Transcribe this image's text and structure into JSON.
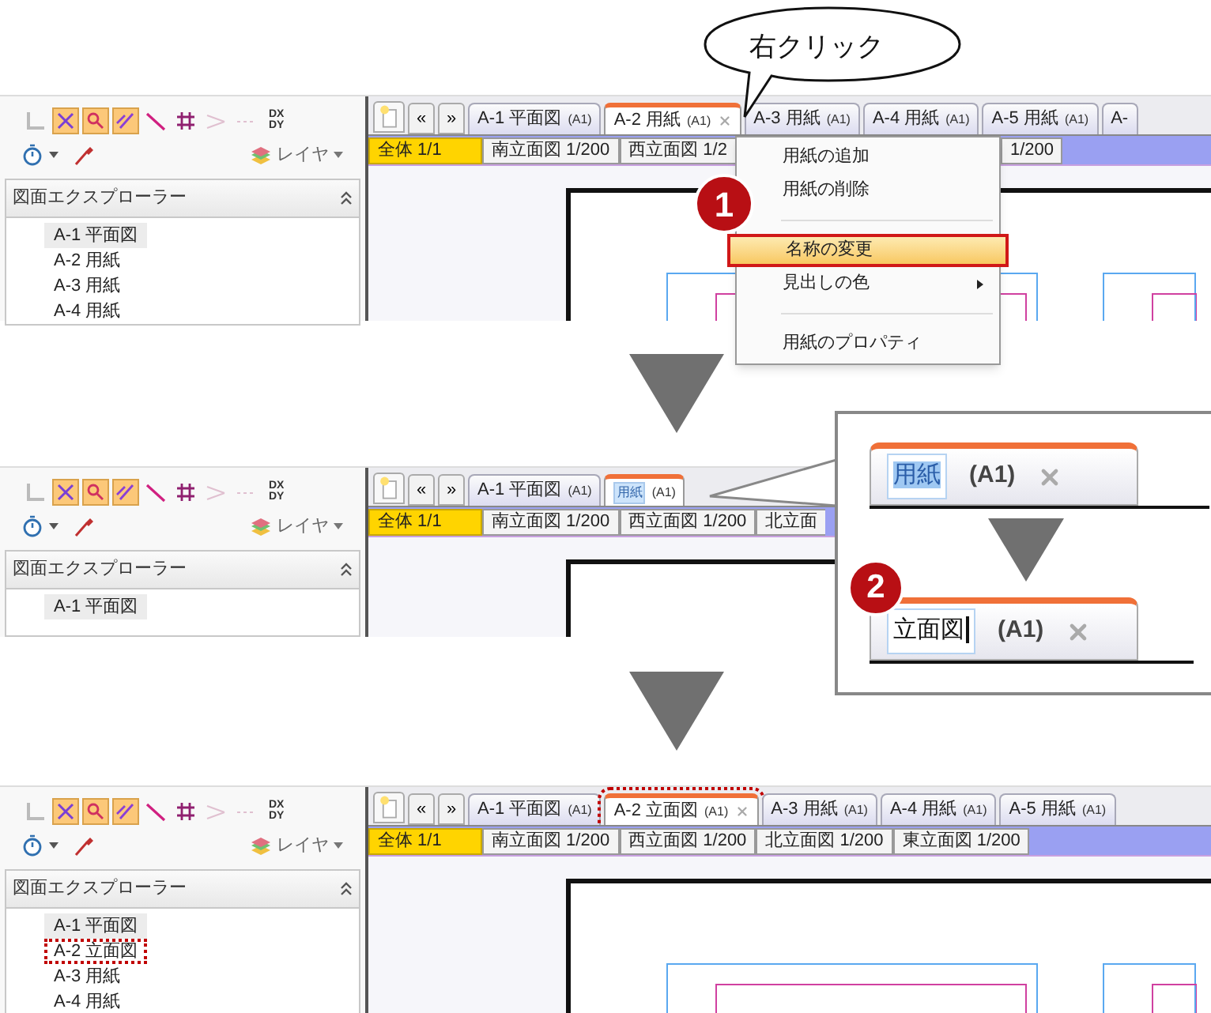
{
  "bubble": {
    "text": "右クリック"
  },
  "steps": [
    {
      "nav": {
        "prev": "«",
        "next": "»"
      },
      "toolbar": {
        "dxdy": "DX DY",
        "layer": "レイヤ"
      },
      "explorer": {
        "title": "図面エクスプローラー",
        "items": [
          {
            "label": "A-1 平面図",
            "selected": true,
            "marked": false
          },
          {
            "label": "A-2 用紙",
            "selected": false,
            "marked": false
          },
          {
            "label": "A-3 用紙",
            "selected": false,
            "marked": false
          },
          {
            "label": "A-4 用紙",
            "selected": false,
            "marked": false
          }
        ]
      },
      "page_tabs": [
        {
          "kind": "tab",
          "label": "A-1 平面図",
          "size": "(A1)",
          "selected": false,
          "marked": false
        },
        {
          "kind": "tab",
          "label": "A-2 用紙",
          "size": "(A1)",
          "selected": true,
          "marked": false
        },
        {
          "kind": "tab",
          "label": "A-3 用紙",
          "size": "(A1)",
          "selected": false,
          "marked": false
        },
        {
          "kind": "tab",
          "label": "A-4 用紙",
          "size": "(A1)",
          "selected": false,
          "marked": false
        },
        {
          "kind": "tab",
          "label": "A-5 用紙",
          "size": "(A1)",
          "selected": false,
          "marked": false
        },
        {
          "kind": "cut",
          "label": "A-",
          "selected": false,
          "marked": false
        }
      ],
      "sheet_tabs": [
        {
          "kind": "tab",
          "label": "全体 1/1",
          "selected": true
        },
        {
          "kind": "tab",
          "label": "南立面図 1/200",
          "selected": false
        },
        {
          "kind": "cut",
          "label": "西立面図 1/2",
          "selected": false
        },
        {
          "kind": "tail",
          "label": "1/200",
          "selected": false
        }
      ],
      "context_menu": {
        "badge": "1",
        "items": [
          {
            "kind": "item",
            "label": "用紙の追加",
            "marked": false,
            "submenu": false
          },
          {
            "kind": "item",
            "label": "用紙の削除",
            "marked": false,
            "submenu": false
          },
          {
            "kind": "separator"
          },
          {
            "kind": "item",
            "label": "名称の変更",
            "marked": true,
            "submenu": false
          },
          {
            "kind": "item",
            "label": "見出しの色",
            "marked": false,
            "submenu": true
          },
          {
            "kind": "separator"
          },
          {
            "kind": "item",
            "label": "用紙のプロパティ",
            "marked": false,
            "submenu": false
          }
        ]
      }
    },
    {
      "nav": {
        "prev": "«",
        "next": "»"
      },
      "toolbar": {
        "dxdy": "DX DY",
        "layer": "レイヤ"
      },
      "explorer": {
        "title": "図面エクスプローラー",
        "items": [
          {
            "label": "A-1 平面図",
            "selected": true,
            "marked": false
          }
        ]
      },
      "page_tabs": [
        {
          "kind": "tab",
          "label": "A-1 平面図",
          "size": "(A1)",
          "selected": false,
          "marked": false
        },
        {
          "kind": "editing",
          "label": "用紙",
          "size": "(A1)",
          "selected": true,
          "marked": false
        }
      ],
      "sheet_tabs": [
        {
          "kind": "tab",
          "label": "全体 1/1",
          "selected": true
        },
        {
          "kind": "tab",
          "label": "南立面図 1/200",
          "selected": false
        },
        {
          "kind": "tab",
          "label": "西立面図 1/200",
          "selected": false
        },
        {
          "kind": "cut",
          "label": "北立面",
          "selected": false
        }
      ]
    },
    {
      "nav": {
        "prev": "«",
        "next": "»"
      },
      "toolbar": {
        "dxdy": "DX DY",
        "layer": "レイヤ"
      },
      "explorer": {
        "title": "図面エクスプローラー",
        "items": [
          {
            "label": "A-1 平面図",
            "selected": true,
            "marked": false
          },
          {
            "label": "A-2 立面図",
            "selected": false,
            "marked": true
          },
          {
            "label": "A-3 用紙",
            "selected": false,
            "marked": false
          },
          {
            "label": "A-4 用紙",
            "selected": false,
            "marked": false
          }
        ]
      },
      "page_tabs": [
        {
          "kind": "tab",
          "label": "A-1 平面図",
          "size": "(A1)",
          "selected": false,
          "marked": false
        },
        {
          "kind": "tab",
          "label": "A-2 立面図",
          "size": "(A1)",
          "selected": true,
          "marked": true
        },
        {
          "kind": "tab",
          "label": "A-3 用紙",
          "size": "(A1)",
          "selected": false,
          "marked": false
        },
        {
          "kind": "tab",
          "label": "A-4 用紙",
          "size": "(A1)",
          "selected": false,
          "marked": false
        },
        {
          "kind": "tab",
          "label": "A-5 用紙",
          "size": "(A1)",
          "selected": false,
          "marked": false
        }
      ],
      "sheet_tabs": [
        {
          "kind": "tab",
          "label": "全体 1/1",
          "selected": true
        },
        {
          "kind": "tab",
          "label": "南立面図 1/200",
          "selected": false
        },
        {
          "kind": "tab",
          "label": "西立面図 1/200",
          "selected": false
        },
        {
          "kind": "tab",
          "label": "北立面図 1/200",
          "selected": false
        },
        {
          "kind": "tab",
          "label": "東立面図 1/200",
          "selected": false
        }
      ]
    }
  ],
  "zoom_callout": {
    "badge": "2",
    "before": {
      "label": "用紙",
      "size": "(A1)"
    },
    "after": {
      "label": "立面図",
      "size": "(A1)"
    }
  }
}
